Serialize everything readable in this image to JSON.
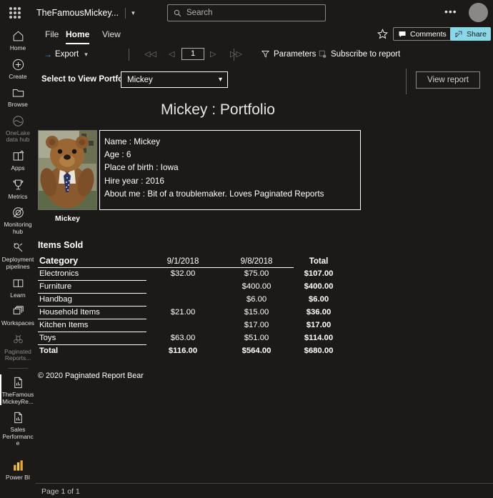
{
  "suitebar": {
    "waffle_icon": "waffle-grid-icon",
    "workspace_name": "TheFamousMickey...",
    "chevron_icon": "chevron-down-icon",
    "search": {
      "icon": "search-icon",
      "placeholder": "Search",
      "value": ""
    },
    "more_label": "•••",
    "avatar_label": ""
  },
  "rail": {
    "items": [
      {
        "label": "Home",
        "icon": "home-icon",
        "active": false
      },
      {
        "label": "Create",
        "icon": "plus-circle-icon",
        "active": false
      },
      {
        "label": "Browse",
        "icon": "folder-icon",
        "active": false
      },
      {
        "label": "OneLake data hub",
        "icon": "onelake-icon",
        "active": false
      },
      {
        "label": "Apps",
        "icon": "apps-icon",
        "active": false
      },
      {
        "label": "Metrics",
        "icon": "trophy-icon",
        "active": false
      },
      {
        "label": "Monitoring hub",
        "icon": "monitoring-icon",
        "active": false
      },
      {
        "label": "Deployment pipelines",
        "icon": "deployment-pipelines-icon",
        "active": false
      },
      {
        "label": "Learn",
        "icon": "learn-book-icon",
        "active": false
      },
      {
        "label": "Workspaces",
        "icon": "workspaces-icon",
        "active": false
      },
      {
        "label": "Paginated Reports...",
        "icon": "paginated-reports-icon",
        "active": false
      },
      {
        "label": "TheFamous MickeyRe...",
        "icon": "report-file-icon",
        "active": true
      },
      {
        "label": "Sales Performance",
        "icon": "report-file-icon",
        "active": false
      },
      {
        "label": "Power BI",
        "icon": "power-bi-logo-icon",
        "active": false
      }
    ]
  },
  "ribbon": {
    "tabs": [
      {
        "id": "file",
        "label": "File",
        "selected": false
      },
      {
        "id": "home",
        "label": "Home",
        "selected": true
      },
      {
        "id": "view",
        "label": "View",
        "selected": false
      }
    ],
    "favorite_icon": "star-icon",
    "comments_label": "Comments",
    "comments_icon": "comment-icon",
    "share_label": "Share",
    "share_icon": "share-icon",
    "share_bg": "#8ad7e8"
  },
  "commandbar": {
    "export_label": "Export",
    "export_icon": "export-arrow-icon",
    "export_chevron": "chevron-down-icon",
    "first_page_icon": "◁◁",
    "prev_page_icon": "◁",
    "next_page_icon": "▷",
    "last_page_icon": "▷▷",
    "page_number": "1",
    "parameters_label": "Parameters",
    "parameters_icon": "filter-funnel-icon",
    "subscribe_label": "Subscribe to report",
    "subscribe_icon": "subscribe-icon"
  },
  "parameters": {
    "portfolio_label": "Select to View Portfolio",
    "portfolio_value": "Mickey",
    "portfolio_chevron": "chevron-down-icon",
    "view_report_label": "View report"
  },
  "report": {
    "title": "Mickey : Portfolio",
    "photo_caption": "Mickey",
    "photo_alt": "teddy-bear-photo",
    "info": {
      "name": "Name : Mickey",
      "age": "Age : 6",
      "birthplace": "Place of birth : Iowa",
      "hire_year": "Hire year : 2016",
      "about": "About me : Bit of a troublemaker.  Loves Paginated Reports"
    },
    "items_sold_title": "Items Sold",
    "copyright": "© 2020 Paginated Report Bear"
  },
  "chart_data": {
    "type": "table",
    "title": "Items Sold",
    "columns": [
      "Category",
      "9/1/2018",
      "9/8/2018",
      "Total"
    ],
    "rows": [
      {
        "category": "Electronics",
        "d1": "$32.00",
        "d2": "$75.00",
        "total": "$107.00"
      },
      {
        "category": "Furniture",
        "d1": "",
        "d2": "$400.00",
        "total": "$400.00"
      },
      {
        "category": "Handbag",
        "d1": "",
        "d2": "$6.00",
        "total": "$6.00"
      },
      {
        "category": "Household Items",
        "d1": "$21.00",
        "d2": "$15.00",
        "total": "$36.00"
      },
      {
        "category": "Kitchen Items",
        "d1": "",
        "d2": "$17.00",
        "total": "$17.00"
      },
      {
        "category": "Toys",
        "d1": "$63.00",
        "d2": "$51.00",
        "total": "$114.00"
      }
    ],
    "total_row": {
      "category": "Total",
      "d1": "$116.00",
      "d2": "$564.00",
      "total": "$680.00"
    }
  },
  "statusbar": {
    "page_text": "Page 1 of 1"
  }
}
